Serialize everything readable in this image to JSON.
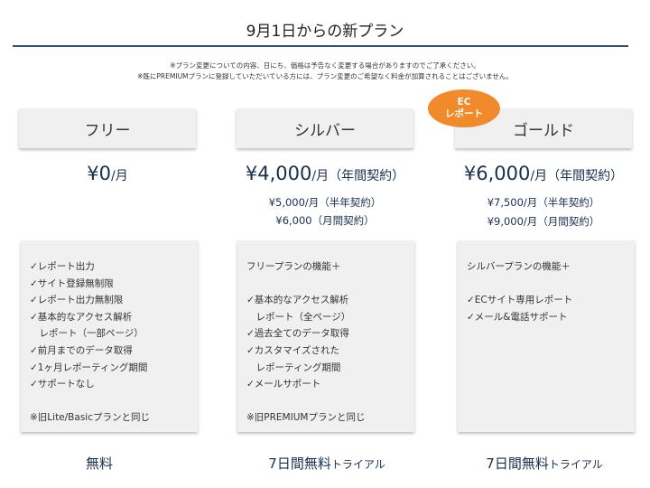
{
  "header": {
    "title": "9月1日からの新プラン",
    "notice_1": "※プラン変更についての内容、日にち、価格は予告なく変更する場合がありますのでご了承ください。",
    "notice_2": "※既にPREMIUMプランに登録していただいている方には、プラン変更のご希望なく料金が加算されることはございません。"
  },
  "badge": {
    "line1": "EC",
    "line2": "レポート"
  },
  "plans": [
    {
      "name": "フリー",
      "price_amount": "¥0",
      "price_unit": "/月",
      "sub_prices": [],
      "features": [
        "✓レポート出力",
        "✓サイト登録無制限",
        "✓レポート出力無制限",
        "✓基本的なアクセス解析",
        "　レポート（一部ページ）",
        "✓前月までのデータ取得",
        "✓1ヶ月レポーティング期間",
        "✓サポートなし",
        "",
        "※旧Lite/Basicプランと同じ"
      ],
      "footer_big": "無料",
      "footer_small": ""
    },
    {
      "name": "シルバー",
      "price_amount": "¥4,000",
      "price_unit": "/月（年間契約）",
      "sub_prices": [
        "¥5,000/月（半年契約）",
        "¥6,000（月間契約）"
      ],
      "features": [
        "フリープランの機能＋",
        "",
        "✓基本的なアクセス解析",
        "　レポート（全ページ）",
        "✓過去全てのデータ取得",
        "✓カスタマイズされた",
        "　レポーティング期間",
        "✓メールサポート",
        "",
        "※旧PREMIUMプランと同じ"
      ],
      "footer_big": "7日間無料",
      "footer_small": "トライアル"
    },
    {
      "name": "ゴールド",
      "price_amount": "¥6,000",
      "price_unit": "/月（年間契約）",
      "sub_prices": [
        "¥7,500/月（半年契約）",
        "¥9,000/月（月間契約）"
      ],
      "features": [
        "シルバープランの機能＋",
        "",
        "✓ECサイト専用レポート",
        "✓メール&電話サポート"
      ],
      "footer_big": "7日間無料",
      "footer_small": "トライアル"
    }
  ]
}
